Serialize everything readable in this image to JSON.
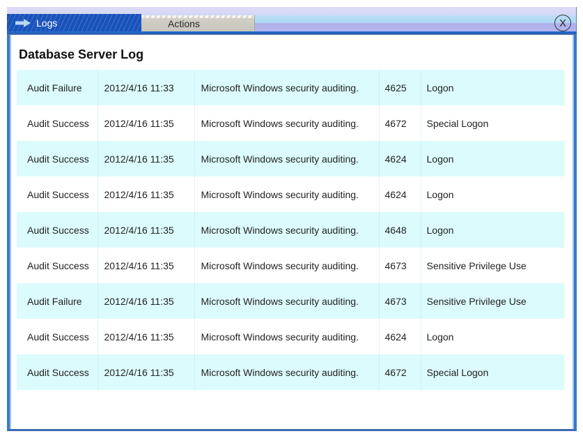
{
  "tabs": [
    {
      "label": "Logs",
      "icon": "arrow-right-icon",
      "active": true
    },
    {
      "label": "Actions",
      "active": false
    }
  ],
  "close_label": "X",
  "page_title": "Database Server Log",
  "colors": {
    "tab_active": "#1a52b8",
    "row_alt": "#dcfbfd",
    "frame_border": "#3a78c8"
  },
  "log_rows": [
    {
      "level": "Audit Failure",
      "date": "2012/4/16 11:33",
      "source": "Microsoft Windows security auditing.",
      "event_id": "4625",
      "category": "Logon"
    },
    {
      "level": "Audit Success",
      "date": "2012/4/16 11:35",
      "source": "Microsoft Windows security auditing.",
      "event_id": "4672",
      "category": "Special Logon"
    },
    {
      "level": "Audit Success",
      "date": "2012/4/16 11:35",
      "source": "Microsoft Windows security auditing.",
      "event_id": "4624",
      "category": "Logon"
    },
    {
      "level": "Audit Success",
      "date": "2012/4/16 11:35",
      "source": "Microsoft Windows security auditing.",
      "event_id": "4624",
      "category": "Logon"
    },
    {
      "level": "Audit Success",
      "date": "2012/4/16 11:35",
      "source": "Microsoft Windows security auditing.",
      "event_id": "4648",
      "category": "Logon"
    },
    {
      "level": "Audit Success",
      "date": "2012/4/16 11:35",
      "source": "Microsoft Windows security auditing.",
      "event_id": "4673",
      "category": "Sensitive Privilege Use"
    },
    {
      "level": "Audit Failure",
      "date": "2012/4/16 11:35",
      "source": "Microsoft Windows security auditing.",
      "event_id": "4673",
      "category": "Sensitive Privilege Use"
    },
    {
      "level": "Audit Success",
      "date": "2012/4/16 11:35",
      "source": "Microsoft Windows security auditing.",
      "event_id": "4624",
      "category": "Logon"
    },
    {
      "level": "Audit Success",
      "date": "2012/4/16 11:35",
      "source": "Microsoft Windows security auditing.",
      "event_id": "4672",
      "category": "Special Logon"
    }
  ]
}
